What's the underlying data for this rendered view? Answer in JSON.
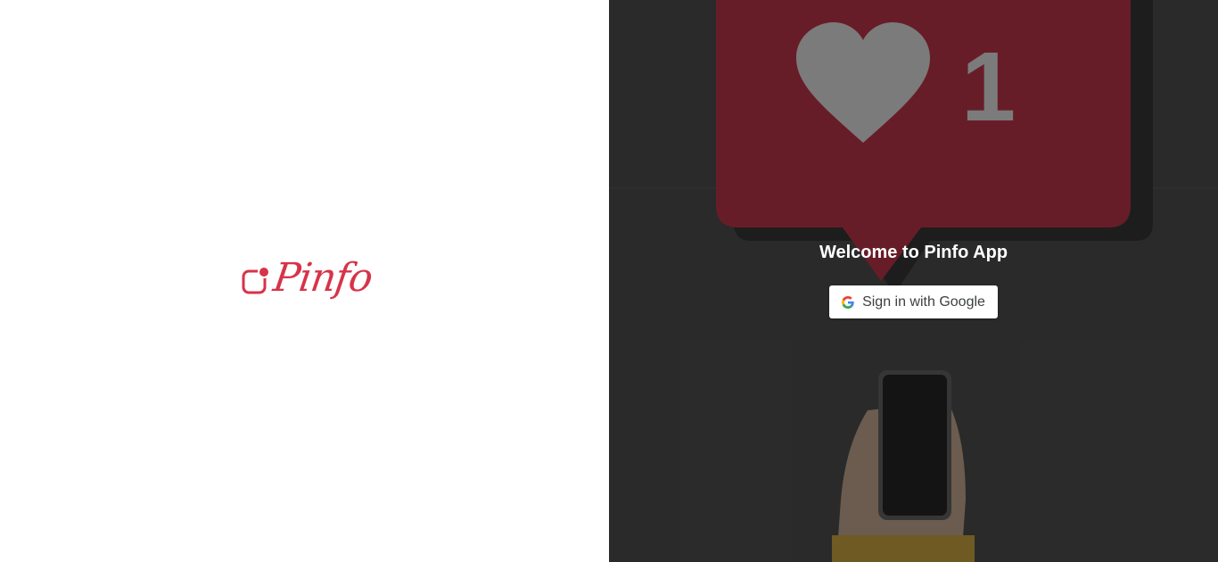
{
  "brand": {
    "name": "Pinfo",
    "accent_color": "#d7334a",
    "logo_icon": "pinfo-logo-mark"
  },
  "auth": {
    "welcome_text": "Welcome to Pinfo App",
    "google_button_label": "Sign in with Google",
    "google_icon": "google-g-icon"
  },
  "hero": {
    "image_subject": "red like notification bubble with heart and 1 above a hand holding a phone",
    "like_count": "1"
  }
}
